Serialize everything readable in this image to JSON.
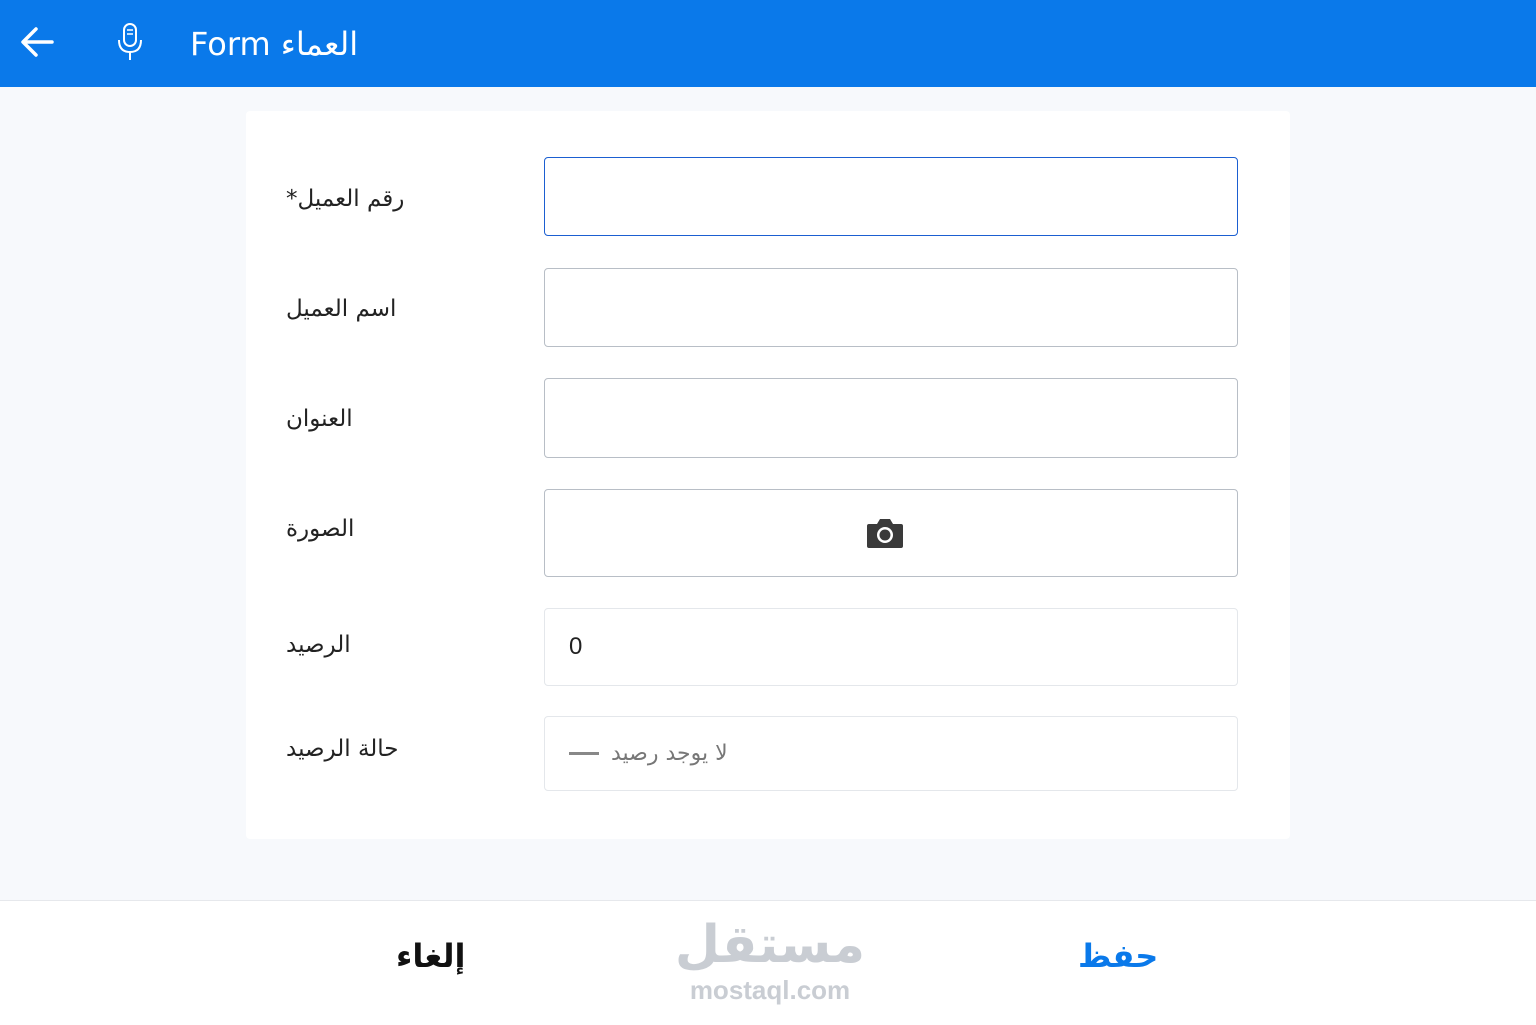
{
  "header": {
    "title": "العماء Form",
    "back_icon": "arrow-left-icon",
    "mic_icon": "microphone-icon",
    "background": "#0a79ea"
  },
  "form": {
    "fields": [
      {
        "label": "رقم العميل*",
        "value": "",
        "state": "focused"
      },
      {
        "label": "اسم العميل",
        "value": ""
      },
      {
        "label": "العنوان",
        "value": ""
      },
      {
        "label": "الصورة",
        "icon": "camera-icon"
      },
      {
        "label": "الرصيد",
        "value": "0"
      },
      {
        "label": "حالة الرصيد",
        "value": "لا يوجد رصيد"
      }
    ]
  },
  "footer": {
    "cancel_label": "إلغاء",
    "save_label": "حفظ",
    "watermark_ar": "مستقل",
    "watermark_en": "mostaql.com",
    "save_color": "#0a79ea"
  }
}
